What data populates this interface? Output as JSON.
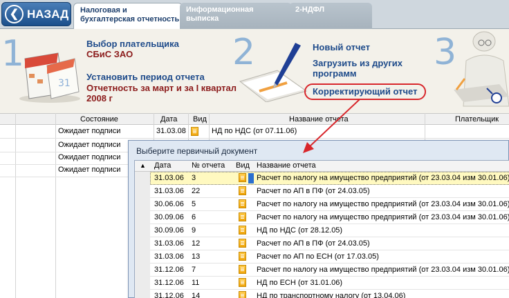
{
  "topbar": {
    "back_label": "НАЗАД",
    "tabs": [
      {
        "line1": "Налоговая и",
        "line2": "бухгалтерская отчетность"
      },
      {
        "line1": "Информационная",
        "line2": "выписка"
      },
      {
        "line1": "2-НДФЛ",
        "line2": ""
      }
    ]
  },
  "banner": {
    "steps": [
      "1",
      "2",
      "3"
    ],
    "payer_link": "Выбор плательщика",
    "payer_value": "СБиС ЗАО",
    "period_link": "Установить период отчета",
    "period_value_line1": "Отчетность за март и за I квартал",
    "period_value_line2": "2008 г",
    "new_report": "Новый отчет",
    "load_line1": "Загрузить из других",
    "load_line2": "программ",
    "corrective": "Корректирующий отчет"
  },
  "main_table": {
    "headers": [
      "Состояние",
      "Дата",
      "Вид",
      "Название отчета",
      "Плательщик"
    ],
    "rows": [
      {
        "status": "Ожидает подписи",
        "date": "31.03.08",
        "name": "НД по НДС (от 07.11.06)"
      },
      {
        "status": "Ожидает подписи",
        "date": "",
        "name": ""
      },
      {
        "status": "Ожидает подписи",
        "date": "",
        "name": ""
      },
      {
        "status": "Ожидает подписи",
        "date": "",
        "name": ""
      }
    ]
  },
  "dialog": {
    "title": "Выберите первичный документ",
    "headers": [
      "Дата",
      "№ отчета",
      "Вид",
      "Название отчета"
    ],
    "rows": [
      {
        "date": "31.03.06",
        "num": "3",
        "name": "Расчет по налогу на имущество предприятий (от 23.03.04 изм 30.01.06)"
      },
      {
        "date": "31.03.06",
        "num": "22",
        "name": "Расчет по АП в ПФ (от 24.03.05)"
      },
      {
        "date": "30.06.06",
        "num": "5",
        "name": "Расчет по налогу на имущество предприятий (от 23.03.04 изм 30.01.06)"
      },
      {
        "date": "30.09.06",
        "num": "6",
        "name": "Расчет по налогу на имущество предприятий (от 23.03.04 изм 30.01.06)"
      },
      {
        "date": "30.09.06",
        "num": "9",
        "name": "НД по НДС (от 28.12.05)"
      },
      {
        "date": "31.03.06",
        "num": "12",
        "name": "Расчет по АП в ПФ (от 24.03.05)"
      },
      {
        "date": "31.03.06",
        "num": "13",
        "name": "Расчет по АП по ЕСН (от 17.03.05)"
      },
      {
        "date": "31.12.06",
        "num": "7",
        "name": "Расчет по налогу на имущество предприятий (от 23.03.04 изм 30.01.06)"
      },
      {
        "date": "31.12.06",
        "num": "11",
        "name": "НД по ЕСН (от 31.01.06)"
      },
      {
        "date": "31.12.06",
        "num": "14",
        "name": "НД по транспортному налогу (от 13.04.06)"
      }
    ]
  },
  "colors": {
    "accent": "#1d4a8a",
    "highlight_oval": "#d8262b",
    "arrow": "#d8262b",
    "selected_row": "#fff9c0"
  }
}
